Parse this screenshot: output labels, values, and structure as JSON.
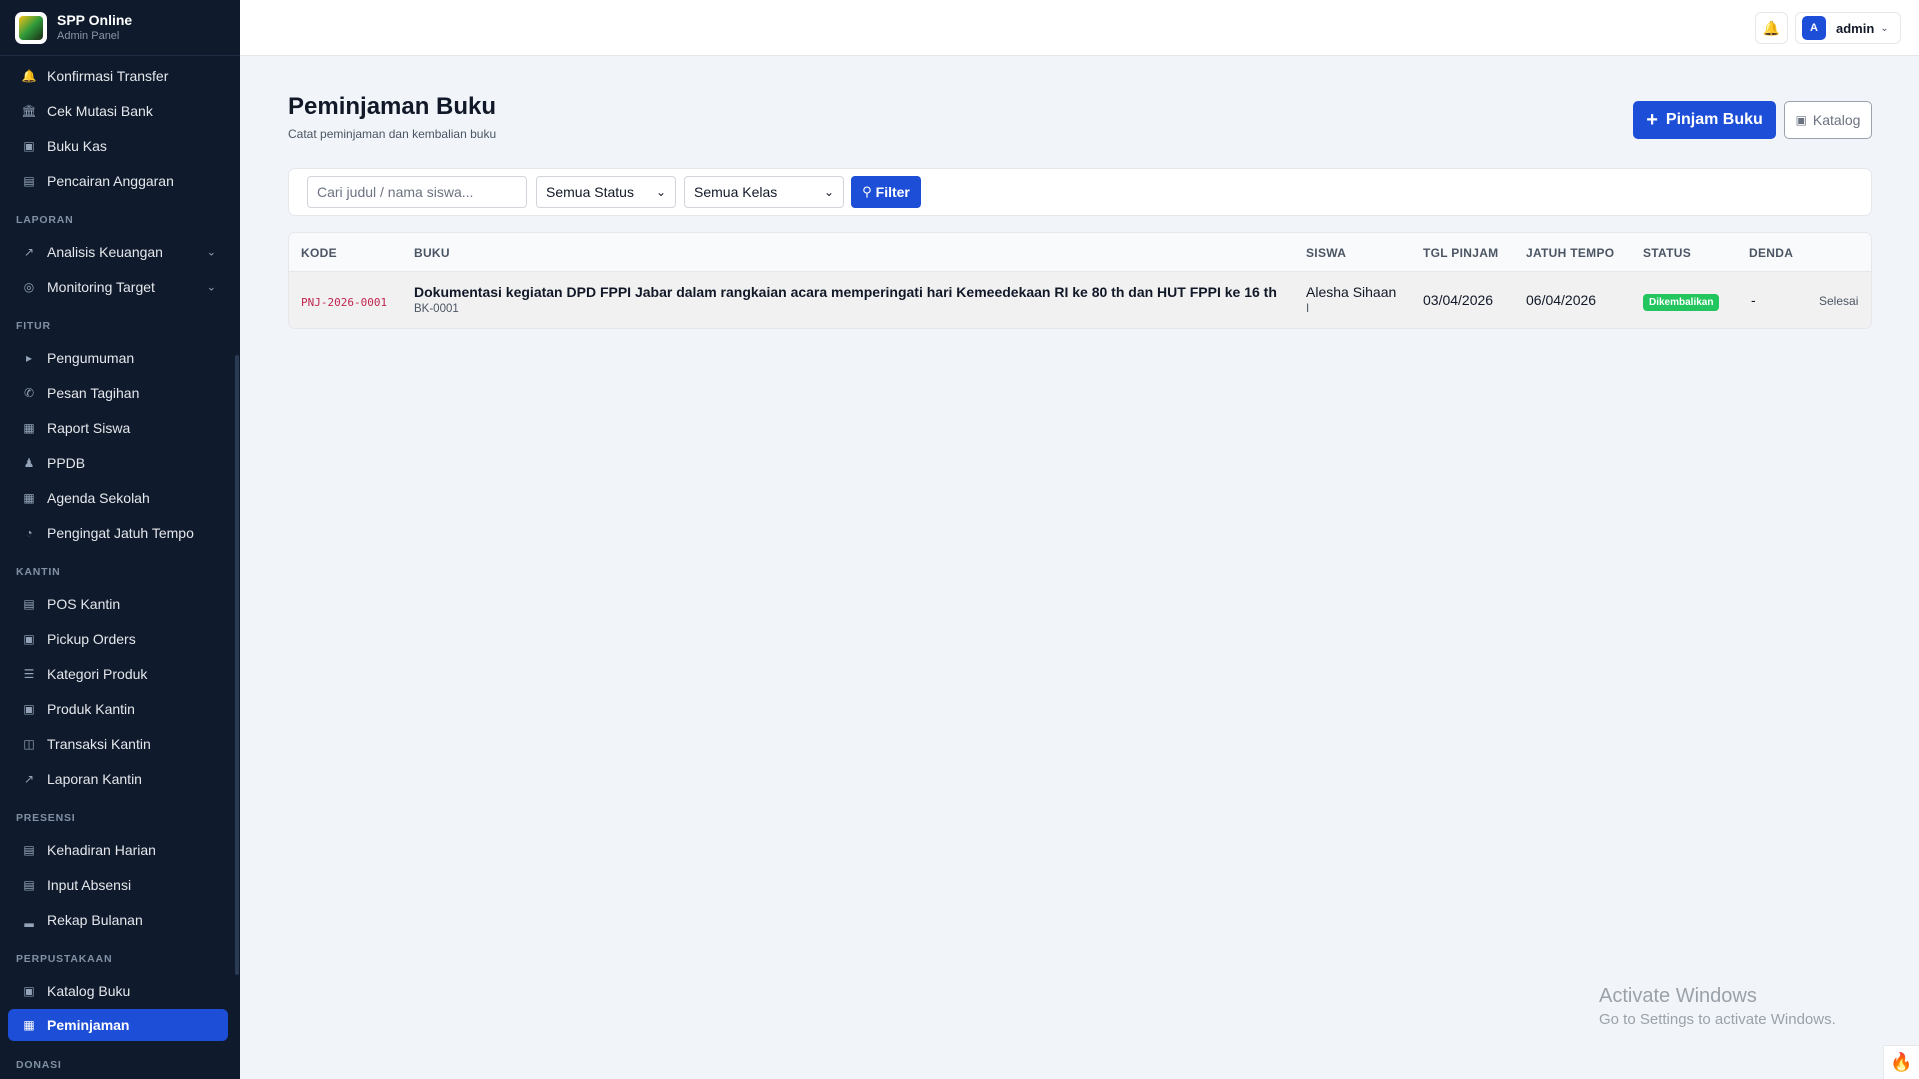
{
  "brand": {
    "title": "SPP Online",
    "subtitle": "Admin Panel"
  },
  "sidebar": {
    "items_top": [
      {
        "label": "Konfirmasi Transfer",
        "icon": "bell-icon"
      },
      {
        "label": "Cek Mutasi Bank",
        "icon": "bank-icon"
      },
      {
        "label": "Buku Kas",
        "icon": "book-icon"
      },
      {
        "label": "Pencairan Anggaran",
        "icon": "wallet-icon"
      }
    ],
    "section_laporan": "LAPORAN",
    "items_laporan": [
      {
        "label": "Analisis Keuangan",
        "icon": "chart-line-icon"
      },
      {
        "label": "Monitoring Target",
        "icon": "target-icon"
      }
    ],
    "section_fitur": "FITUR",
    "items_fitur": [
      {
        "label": "Pengumuman",
        "icon": "megaphone-icon"
      },
      {
        "label": "Pesan Tagihan",
        "icon": "whatsapp-icon"
      },
      {
        "label": "Raport Siswa",
        "icon": "open-book-icon"
      },
      {
        "label": "PPDB",
        "icon": "user-plus-icon"
      },
      {
        "label": "Agenda Sekolah",
        "icon": "calendar-icon"
      },
      {
        "label": "Pengingat Jatuh Tempo",
        "icon": "clock-icon"
      }
    ],
    "section_kantin": "KANTIN",
    "items_kantin": [
      {
        "label": "POS Kantin",
        "icon": "cash-register-icon"
      },
      {
        "label": "Pickup Orders",
        "icon": "shopping-bag-icon"
      },
      {
        "label": "Kategori Produk",
        "icon": "list-icon"
      },
      {
        "label": "Produk Kantin",
        "icon": "box-icon"
      },
      {
        "label": "Transaksi Kantin",
        "icon": "cart-icon"
      },
      {
        "label": "Laporan Kantin",
        "icon": "chart-line-icon"
      }
    ],
    "section_presensi": "PRESENSI",
    "items_presensi": [
      {
        "label": "Kehadiran Harian",
        "icon": "clipboard-icon"
      },
      {
        "label": "Input Absensi",
        "icon": "clipboard-check-icon"
      },
      {
        "label": "Rekap Bulanan",
        "icon": "chart-bar-icon"
      }
    ],
    "section_perpustakaan": "PERPUSTAKAAN",
    "items_perpustakaan": [
      {
        "label": "Katalog Buku",
        "icon": "book-icon"
      },
      {
        "label": "Peminjaman",
        "icon": "open-book-icon"
      }
    ],
    "section_donasi": "DONASI"
  },
  "topbar": {
    "user_initial": "A",
    "user_name": "admin"
  },
  "page": {
    "title": "Peminjaman Buku",
    "subtitle": "Catat peminjaman dan kembalian buku",
    "btn_pinjam": "Pinjam Buku",
    "btn_katalog": "Katalog"
  },
  "filter": {
    "search_placeholder": "Cari judul / nama siswa...",
    "status_value": "Semua Status",
    "kelas_value": "Semua Kelas",
    "btn_filter": "Filter"
  },
  "table": {
    "headers": [
      "KODE",
      "BUKU",
      "SISWA",
      "TGL PINJAM",
      "JATUH TEMPO",
      "STATUS",
      "DENDA"
    ],
    "rows": [
      {
        "kode": "PNJ-2026-0001",
        "buku_title": "Dokumentasi kegiatan DPD FPPI Jabar dalam rangkaian acara memperingati hari Kemeedekaan RI ke 80 th dan HUT FPPI ke 16 th",
        "buku_code": "BK-0001",
        "siswa_name": "Alesha Sihaan",
        "siswa_class": "I",
        "tgl_pinjam": "03/04/2026",
        "jatuh_tempo": "06/04/2026",
        "status": "Dikembalikan",
        "denda": "-",
        "aksi": "Selesai"
      }
    ]
  },
  "watermark": {
    "line1": "Activate Windows",
    "line2": "Go to Settings to activate Windows."
  },
  "colors": {
    "sidebar_bg": "#0f1b2d",
    "primary": "#1d4ed8",
    "success": "#22c55e",
    "code": "#c0264f"
  }
}
